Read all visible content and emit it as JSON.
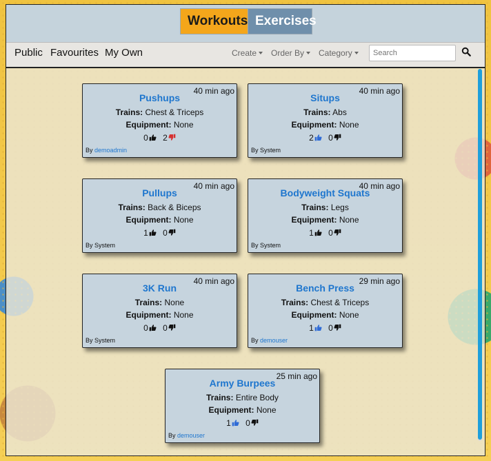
{
  "tabs": {
    "workouts": "Workouts",
    "exercises": "Exercises"
  },
  "nav": {
    "public": "Public",
    "favourites": "Favourites",
    "my_own": "My Own"
  },
  "dropdowns": {
    "create": "Create",
    "order_by": "Order By",
    "category": "Category"
  },
  "search": {
    "placeholder": "Search"
  },
  "labels": {
    "trains": "Trains:",
    "equipment": "Equipment:",
    "by": "By"
  },
  "colors": {
    "like_active": "#2f6bd6",
    "dislike_active": "#d63131",
    "inactive": "#111111"
  },
  "cards": [
    {
      "title": "Pushups",
      "time": "40 min ago",
      "trains": "Chest & Triceps",
      "equipment": "None",
      "likes": "0",
      "dislikes": "2",
      "like_state": "neutral",
      "dislike_state": "active",
      "author": "demoadmin",
      "author_link": true
    },
    {
      "title": "Situps",
      "time": "40 min ago",
      "trains": "Abs",
      "equipment": "None",
      "likes": "2",
      "dislikes": "0",
      "like_state": "active",
      "dislike_state": "neutral",
      "author": "System",
      "author_link": false
    },
    {
      "title": "Pullups",
      "time": "40 min ago",
      "trains": "Back & Biceps",
      "equipment": "None",
      "likes": "1",
      "dislikes": "0",
      "like_state": "neutral",
      "dislike_state": "neutral",
      "author": "System",
      "author_link": false
    },
    {
      "title": "Bodyweight Squats",
      "time": "40 min ago",
      "trains": "Legs",
      "equipment": "None",
      "likes": "1",
      "dislikes": "0",
      "like_state": "neutral",
      "dislike_state": "neutral",
      "author": "System",
      "author_link": false
    },
    {
      "title": "3K Run",
      "time": "40 min ago",
      "trains": "None",
      "equipment": "None",
      "likes": "0",
      "dislikes": "0",
      "like_state": "neutral",
      "dislike_state": "neutral",
      "author": "System",
      "author_link": false
    },
    {
      "title": "Bench Press",
      "time": "29 min ago",
      "trains": "Chest & Triceps",
      "equipment": "None",
      "likes": "1",
      "dislikes": "0",
      "like_state": "active",
      "dislike_state": "neutral",
      "author": "demouser",
      "author_link": true
    },
    {
      "title": "Army Burpees",
      "time": "25 min ago",
      "trains": "Entire Body",
      "equipment": "None",
      "likes": "1",
      "dislikes": "0",
      "like_state": "active",
      "dislike_state": "neutral",
      "author": "demouser",
      "author_link": true
    }
  ]
}
